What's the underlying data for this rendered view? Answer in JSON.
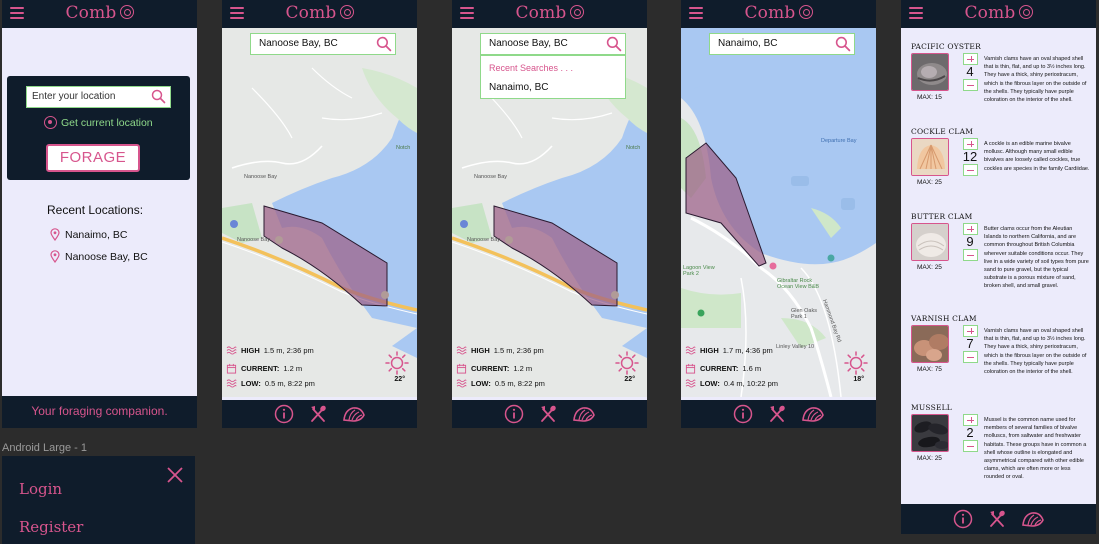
{
  "app": {
    "name": "Comb",
    "tagline": "Your foraging companion."
  },
  "colors": {
    "navy": "#0f1c2b",
    "pink": "#d7558d",
    "green": "#8fd98a",
    "lavender": "#ecebfb",
    "water": "#a9c8f2",
    "polygon": "#9d5f86"
  },
  "home": {
    "location_placeholder": "Enter your location",
    "get_location_label": "Get current location",
    "forage_label": "FORAGE",
    "recent_title": "Recent Locations:",
    "recent": [
      "Nanaimo, BC",
      "Nanoose Bay, BC"
    ]
  },
  "map_screens": [
    {
      "search_value": "Nanoose Bay, BC",
      "tides": {
        "high_label": "HIGH",
        "high": "1.5 m, 2:36 pm",
        "current_label": "CURRENT:",
        "current": "1.2 m",
        "low_label": "LOW:",
        "low": "0.5 m, 8:22 pm"
      },
      "temperature": "22°",
      "map_labels": [
        "Nanoose Bay",
        "Nanoose Bay",
        "Notch"
      ]
    },
    {
      "search_value": "Nanoose Bay, BC",
      "dropdown": {
        "heading": "Recent Searches . . .",
        "item": "Nanaimo, BC"
      },
      "tides": {
        "high_label": "HIGH",
        "high": "1.5 m, 2:36 pm",
        "current_label": "CURRENT:",
        "current": "1.2 m",
        "low_label": "LOW:",
        "low": "0.5 m, 8:22 pm"
      },
      "temperature": "22°",
      "map_labels": [
        "Nanoose Bay",
        "Nanoose Bay",
        "Notch"
      ]
    },
    {
      "search_value": "Nanaimo, BC",
      "tides": {
        "high_label": "HIGH",
        "high": "1.7 m, 4:36 pm",
        "current_label": "CURRENT:",
        "current": "1.6 m",
        "low_label": "LOW:",
        "low": "0.4 m, 10:22 pm"
      },
      "temperature": "18°",
      "map_labels": [
        "Gibraltar Rock Ocean View B&B",
        "Lagoon View Park 2",
        "Glen Oaks Park 1",
        "Linley Valley 10",
        "Departure Bay",
        "Hammond Bay Rd"
      ]
    }
  ],
  "shells": [
    {
      "name": "PACIFIC OYSTER",
      "count": "4",
      "max": "MAX: 15",
      "image": "oyster",
      "description": "Varnish clams have an oval shaped shell that is thin, flat, and up to 3½ inches long. They have a thick, shiny periostracum, which is the fibrous layer on the outside of the shells. They typically have purple coloration on the interior of the shell."
    },
    {
      "name": "COCKLE CLAM",
      "count": "12",
      "max": "MAX: 25",
      "image": "cockle",
      "description": "A cockle is an edible marine bivalve mollusc. Although many small edible bivalves are loosely called cockles, true cockles are species in the family Cardiidae."
    },
    {
      "name": "BUTTER CLAM",
      "count": "9",
      "max": "MAX: 25",
      "image": "butter",
      "description": "Butter clams occur from the Aleutian Islands to northern California, and are common throughout British Columbia wherever suitable conditions occur. They live in a wide variety of soil types from pure sand to pure gravel, but the typical substrate is a porous mixture of sand, broken shell, and small gravel."
    },
    {
      "name": "VARNISH CLAM",
      "count": "7",
      "max": "MAX: 75",
      "image": "varnish",
      "description": "Varnish clams have an oval shaped shell that is thin, flat, and up to 3½ inches long. They have a thick, shiny periostracum, which is the fibrous layer on the outside of the shells. They typically have purple coloration on the interior of the shell."
    },
    {
      "name": "MUSSELL",
      "count": "2",
      "max": "MAX: 25",
      "image": "mussel",
      "description": "Mussel is the common name used for members of several families of bivalve molluscs, from saltwater and freshwater habitats. These groups have in common a shell whose outline is elongated and asymmetrical compared with other edible clams, which are often more or less rounded or oval."
    }
  ],
  "frame_label": "Android Large - 1",
  "menu": {
    "items": [
      "Login",
      "Register"
    ]
  },
  "icons": {
    "menu": "hamburger-icon",
    "search": "search-icon",
    "info": "info-icon",
    "tools": "utensils-icon",
    "shell": "shell-icon",
    "sun": "sun-icon",
    "close": "close-icon",
    "pin": "location-pin-icon",
    "target": "crosshair-icon"
  }
}
